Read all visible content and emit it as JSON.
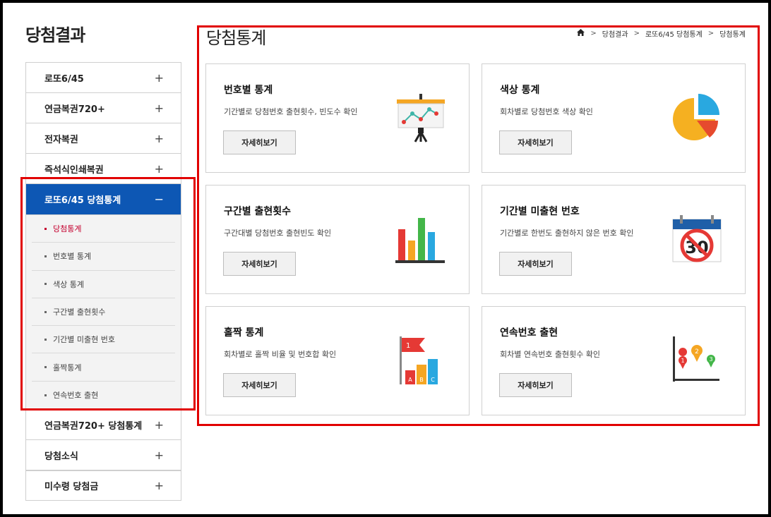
{
  "sidebar": {
    "title": "당첨결과",
    "items_top": [
      {
        "label": "로또6/45",
        "toggle": "+"
      },
      {
        "label": "연금복권720+",
        "toggle": "+"
      },
      {
        "label": "전자복권",
        "toggle": "+"
      },
      {
        "label": "즉석식인쇄복권",
        "toggle": "+"
      }
    ],
    "active": {
      "label": "로또6/45 당첨통계",
      "toggle": "−"
    },
    "sub_items": [
      {
        "label": "당첨통계"
      },
      {
        "label": "번호별 통계"
      },
      {
        "label": "색상 통계"
      },
      {
        "label": "구간별 출현횟수"
      },
      {
        "label": "기간별 미출현 번호"
      },
      {
        "label": "홀짝통계"
      },
      {
        "label": "연속번호 출현"
      }
    ],
    "items_bottom": [
      {
        "label": "연금복권720+ 당첨통계",
        "toggle": "+"
      },
      {
        "label": "당첨소식",
        "toggle": "+"
      },
      {
        "label": "미수령 당첨금",
        "toggle": "+"
      }
    ]
  },
  "main": {
    "title": "당첨통계",
    "breadcrumb": [
      "당첨결과",
      "로또6/45 당첨통계",
      "당첨통계"
    ],
    "cards": [
      {
        "title": "번호별 통계",
        "desc": "기간별로 당첨번호 출현횟수, 빈도수 확인",
        "button": "자세히보기"
      },
      {
        "title": "색상 통계",
        "desc": "회차별로 당첨번호 색상 확인",
        "button": "자세히보기"
      },
      {
        "title": "구간별 출현횟수",
        "desc": "구간대별 당첨번호 출현빈도 확인",
        "button": "자세히보기"
      },
      {
        "title": "기간별 미출현 번호",
        "desc": "기간별로 한번도 출현하지 않은 번호 확인",
        "button": "자세히보기"
      },
      {
        "title": "홀짝 통계",
        "desc": "회차별로 홀짝 비율 및 번호합 확인",
        "button": "자세히보기"
      },
      {
        "title": "연속번호 출현",
        "desc": "회차별 연속번호 출현횟수 확인",
        "button": "자세히보기"
      }
    ],
    "icons": {
      "presentation": {
        "name": "presentation-board-icon"
      },
      "pie": {
        "name": "pie-chart-icon"
      },
      "bars": {
        "name": "bar-chart-icon"
      },
      "calendar": {
        "name": "calendar-no-30-icon",
        "number": "30"
      },
      "flag": {
        "name": "flag-bar-chart-icon",
        "flag_number": "1",
        "bar_letters": [
          "A",
          "B",
          "C"
        ]
      },
      "pins": {
        "name": "map-pins-chart-icon",
        "pin_numbers": [
          "1",
          "2",
          "3"
        ]
      }
    }
  },
  "colors": {
    "active_bg": "#0d57b4",
    "highlight": "#e10000",
    "current_sub": "#c4002f"
  }
}
